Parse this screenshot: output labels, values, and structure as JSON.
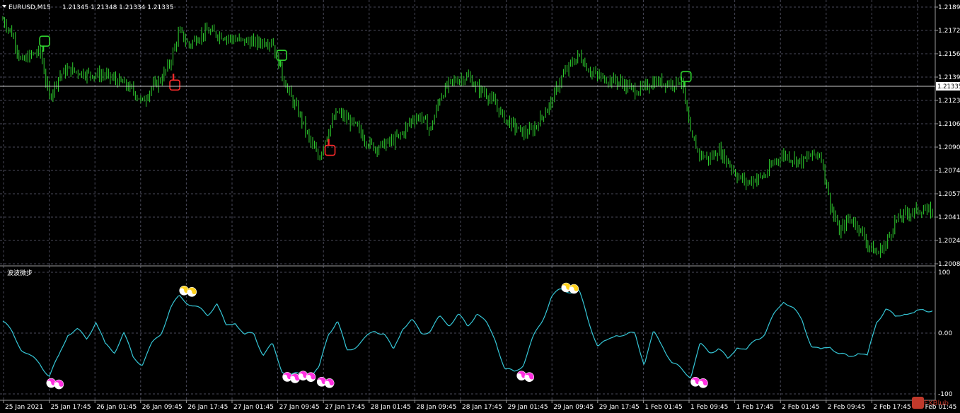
{
  "window": {
    "symbol": "EURUSD,M15",
    "ohlc": "1.21345 1.21348 1.21334 1.21335",
    "indicator_name": "波波微步",
    "watermark": "FXBlub"
  },
  "colors": {
    "background": "#000000",
    "candles": "#2fd12f",
    "oscillator": "#35c6d6",
    "sell_marker": "#ffd21f",
    "buy_marker": "#ff2fe0",
    "arrow_up_price": "#ff2b2b",
    "arrow_down_price": "#2fd12f",
    "grid": "#4a4a5a",
    "text": "#ffffff"
  },
  "chart_data": [
    {
      "type": "candlestick",
      "title": "EURUSD,M15",
      "y_ticks": [
        "1.21890",
        "1.21725",
        "1.21560",
        "1.21395",
        "1.21230",
        "1.21065",
        "1.20900",
        "1.20740",
        "1.20575",
        "1.20410",
        "1.20245",
        "1.20080"
      ],
      "current_price": "1.21335",
      "ylim": [
        1.2008,
        1.2189
      ],
      "x_ticks": [
        "25 Jan 2021",
        "25 Jan 17:45",
        "26 Jan 01:45",
        "26 Jan 09:45",
        "26 Jan 17:45",
        "27 Jan 01:45",
        "27 Jan 09:45",
        "27 Jan 17:45",
        "28 Jan 01:45",
        "28 Jan 09:45",
        "28 Jan 17:45",
        "29 Jan 01:45",
        "29 Jan 09:45",
        "29 Jan 17:45",
        "1 Feb 01:45",
        "1 Feb 09:45",
        "1 Feb 17:45",
        "2 Feb 01:45",
        "2 Feb 09:45",
        "2 Feb 17:45",
        "3 Feb 01:45"
      ],
      "price_path": [
        [
          0.0,
          1.218
        ],
        [
          0.01,
          1.217
        ],
        [
          0.02,
          1.215
        ],
        [
          0.03,
          1.2155
        ],
        [
          0.04,
          1.2158
        ],
        [
          0.05,
          1.2125
        ],
        [
          0.06,
          1.214
        ],
        [
          0.07,
          1.2145
        ],
        [
          0.09,
          1.2142
        ],
        [
          0.11,
          1.2141
        ],
        [
          0.13,
          1.2135
        ],
        [
          0.14,
          1.213
        ],
        [
          0.15,
          1.2122
        ],
        [
          0.16,
          1.2132
        ],
        [
          0.17,
          1.2138
        ],
        [
          0.18,
          1.215
        ],
        [
          0.19,
          1.2172
        ],
        [
          0.2,
          1.2162
        ],
        [
          0.21,
          1.2168
        ],
        [
          0.22,
          1.2172
        ],
        [
          0.24,
          1.2168
        ],
        [
          0.25,
          1.2166
        ],
        [
          0.26,
          1.2165
        ],
        [
          0.27,
          1.2164
        ],
        [
          0.29,
          1.2165
        ],
        [
          0.3,
          1.2142
        ],
        [
          0.31,
          1.2125
        ],
        [
          0.32,
          1.2112
        ],
        [
          0.33,
          1.2095
        ],
        [
          0.34,
          1.2082
        ],
        [
          0.35,
          1.2102
        ],
        [
          0.36,
          1.2115
        ],
        [
          0.37,
          1.211
        ],
        [
          0.38,
          1.2105
        ],
        [
          0.39,
          1.2095
        ],
        [
          0.4,
          1.209
        ],
        [
          0.41,
          1.2092
        ],
        [
          0.42,
          1.2095
        ],
        [
          0.43,
          1.21
        ],
        [
          0.44,
          1.211
        ],
        [
          0.45,
          1.2112
        ],
        [
          0.46,
          1.2102
        ],
        [
          0.47,
          1.2125
        ],
        [
          0.48,
          1.2135
        ],
        [
          0.49,
          1.2138
        ],
        [
          0.5,
          1.214
        ],
        [
          0.51,
          1.2132
        ],
        [
          0.52,
          1.2128
        ],
        [
          0.53,
          1.212
        ],
        [
          0.54,
          1.211
        ],
        [
          0.55,
          1.2105
        ],
        [
          0.56,
          1.21
        ],
        [
          0.57,
          1.2102
        ],
        [
          0.58,
          1.2112
        ],
        [
          0.59,
          1.2122
        ],
        [
          0.6,
          1.2138
        ],
        [
          0.61,
          1.2148
        ],
        [
          0.62,
          1.2155
        ],
        [
          0.63,
          1.2145
        ],
        [
          0.64,
          1.214
        ],
        [
          0.65,
          1.2138
        ],
        [
          0.66,
          1.2137
        ],
        [
          0.67,
          1.2134
        ],
        [
          0.68,
          1.213
        ],
        [
          0.69,
          1.2132
        ],
        [
          0.7,
          1.2136
        ],
        [
          0.71,
          1.2136
        ],
        [
          0.72,
          1.2135
        ],
        [
          0.73,
          1.2138
        ],
        [
          0.74,
          1.2098
        ],
        [
          0.75,
          1.2085
        ],
        [
          0.76,
          1.2082
        ],
        [
          0.77,
          1.2088
        ],
        [
          0.78,
          1.208
        ],
        [
          0.79,
          1.207
        ],
        [
          0.8,
          1.2065
        ],
        [
          0.81,
          1.2068
        ],
        [
          0.82,
          1.207
        ],
        [
          0.83,
          1.208
        ],
        [
          0.84,
          1.2085
        ],
        [
          0.85,
          1.2082
        ],
        [
          0.86,
          1.208
        ],
        [
          0.87,
          1.2085
        ],
        [
          0.88,
          1.2085
        ],
        [
          0.89,
          1.205
        ],
        [
          0.9,
          1.203
        ],
        [
          0.91,
          1.204
        ],
        [
          0.92,
          1.2035
        ],
        [
          0.93,
          1.2022
        ],
        [
          0.94,
          1.2015
        ],
        [
          0.95,
          1.2022
        ],
        [
          0.96,
          1.2038
        ],
        [
          0.97,
          1.2043
        ],
        [
          0.98,
          1.2045
        ],
        [
          0.99,
          1.2046
        ],
        [
          1.0,
          1.2044
        ]
      ],
      "signals": [
        {
          "type": "sell",
          "x": 0.045,
          "price": 1.2164
        },
        {
          "type": "buy",
          "x": 0.185,
          "price": 1.2133
        },
        {
          "type": "sell",
          "x": 0.3,
          "price": 1.2154
        },
        {
          "type": "buy",
          "x": 0.352,
          "price": 1.2087
        },
        {
          "type": "sell",
          "x": 0.735,
          "price": 1.2139
        }
      ]
    },
    {
      "type": "line",
      "title": "波波微步",
      "y_ticks": [
        "100",
        "0.00",
        "-100"
      ],
      "ylim": [
        -100,
        100
      ],
      "oscillator_path": [
        [
          0.0,
          20
        ],
        [
          0.01,
          0
        ],
        [
          0.02,
          -25
        ],
        [
          0.03,
          -40
        ],
        [
          0.04,
          -50
        ],
        [
          0.05,
          -70
        ],
        [
          0.06,
          -40
        ],
        [
          0.07,
          0
        ],
        [
          0.08,
          5
        ],
        [
          0.09,
          -10
        ],
        [
          0.1,
          20
        ],
        [
          0.11,
          -20
        ],
        [
          0.12,
          -30
        ],
        [
          0.13,
          0
        ],
        [
          0.14,
          -40
        ],
        [
          0.15,
          -50
        ],
        [
          0.16,
          -20
        ],
        [
          0.17,
          0
        ],
        [
          0.18,
          40
        ],
        [
          0.19,
          60
        ],
        [
          0.2,
          50
        ],
        [
          0.21,
          40
        ],
        [
          0.22,
          30
        ],
        [
          0.23,
          50
        ],
        [
          0.24,
          10
        ],
        [
          0.25,
          20
        ],
        [
          0.26,
          -5
        ],
        [
          0.27,
          0
        ],
        [
          0.28,
          -35
        ],
        [
          0.29,
          -20
        ],
        [
          0.3,
          -60
        ],
        [
          0.31,
          -70
        ],
        [
          0.32,
          -68
        ],
        [
          0.33,
          -72
        ],
        [
          0.34,
          -60
        ],
        [
          0.35,
          0
        ],
        [
          0.36,
          20
        ],
        [
          0.37,
          -30
        ],
        [
          0.38,
          -20
        ],
        [
          0.39,
          -10
        ],
        [
          0.4,
          5
        ],
        [
          0.41,
          0
        ],
        [
          0.42,
          -30
        ],
        [
          0.43,
          10
        ],
        [
          0.44,
          20
        ],
        [
          0.45,
          0
        ],
        [
          0.46,
          5
        ],
        [
          0.47,
          25
        ],
        [
          0.48,
          15
        ],
        [
          0.49,
          30
        ],
        [
          0.5,
          10
        ],
        [
          0.51,
          35
        ],
        [
          0.52,
          15
        ],
        [
          0.53,
          -10
        ],
        [
          0.54,
          -60
        ],
        [
          0.55,
          -65
        ],
        [
          0.56,
          -50
        ],
        [
          0.57,
          -10
        ],
        [
          0.58,
          20
        ],
        [
          0.59,
          60
        ],
        [
          0.6,
          70
        ],
        [
          0.61,
          70
        ],
        [
          0.62,
          68
        ],
        [
          0.63,
          20
        ],
        [
          0.64,
          -20
        ],
        [
          0.65,
          -15
        ],
        [
          0.66,
          0
        ],
        [
          0.67,
          -5
        ],
        [
          0.68,
          0
        ],
        [
          0.69,
          -50
        ],
        [
          0.7,
          0
        ],
        [
          0.71,
          -20
        ],
        [
          0.72,
          -50
        ],
        [
          0.73,
          -60
        ],
        [
          0.74,
          -70
        ],
        [
          0.75,
          -20
        ],
        [
          0.76,
          -30
        ],
        [
          0.77,
          -25
        ],
        [
          0.78,
          -45
        ],
        [
          0.79,
          -20
        ],
        [
          0.8,
          -30
        ],
        [
          0.81,
          -10
        ],
        [
          0.82,
          0
        ],
        [
          0.83,
          30
        ],
        [
          0.84,
          55
        ],
        [
          0.85,
          40
        ],
        [
          0.86,
          20
        ],
        [
          0.87,
          -20
        ],
        [
          0.88,
          -30
        ],
        [
          0.89,
          -20
        ],
        [
          0.9,
          -35
        ],
        [
          0.91,
          -40
        ],
        [
          0.92,
          -30
        ],
        [
          0.93,
          -40
        ],
        [
          0.94,
          20
        ],
        [
          0.95,
          40
        ],
        [
          0.96,
          25
        ],
        [
          0.97,
          35
        ],
        [
          0.98,
          30
        ],
        [
          0.99,
          40
        ],
        [
          1.0,
          38
        ]
      ],
      "signals": [
        {
          "type": "buy",
          "x": 0.052,
          "value": -82
        },
        {
          "type": "sell",
          "x": 0.195,
          "value": 70
        },
        {
          "type": "buy",
          "x": 0.306,
          "value": -72
        },
        {
          "type": "buy",
          "x": 0.323,
          "value": -70
        },
        {
          "type": "buy",
          "x": 0.343,
          "value": -80
        },
        {
          "type": "sell",
          "x": 0.606,
          "value": 75
        },
        {
          "type": "buy",
          "x": 0.558,
          "value": -70
        },
        {
          "type": "buy",
          "x": 0.745,
          "value": -80
        }
      ]
    }
  ]
}
